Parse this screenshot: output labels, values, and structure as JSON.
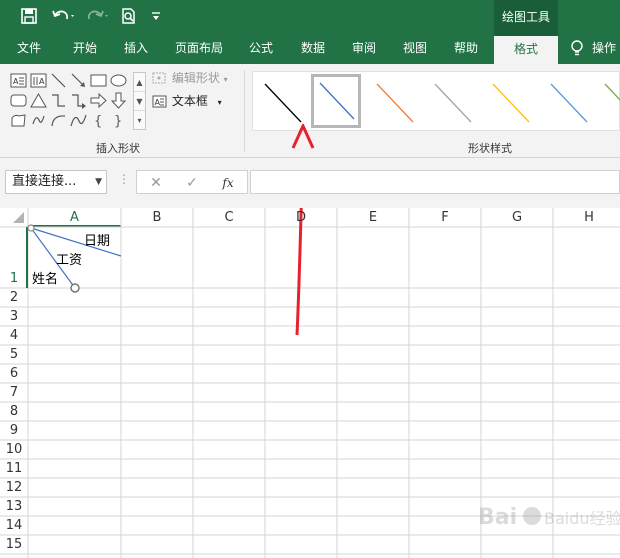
{
  "colors": {
    "accent": "#217346",
    "accent_dark": "#1a5e39",
    "ribbon_bg": "#f3f3f3",
    "annotation_arrow": "#e5222d",
    "diagonal_line": "#4472c4"
  },
  "quick_access": {
    "save_icon": "save-icon",
    "undo_icon": "undo-icon",
    "redo_icon": "redo-icon",
    "print_preview_icon": "print-preview-icon",
    "customize_icon": "customize-toolbar-icon"
  },
  "contextual_tab_group": "绘图工具",
  "tabs": [
    {
      "label": "文件"
    },
    {
      "label": "开始"
    },
    {
      "label": "插入"
    },
    {
      "label": "页面布局"
    },
    {
      "label": "公式"
    },
    {
      "label": "数据"
    },
    {
      "label": "审阅"
    },
    {
      "label": "视图"
    },
    {
      "label": "帮助"
    },
    {
      "label": "格式",
      "active": true
    },
    {
      "label": "操作"
    }
  ],
  "tell_me_icon": "lightbulb-icon",
  "ribbon": {
    "insert_shapes": {
      "group_label": "插入形状",
      "edit_shape_label": "编辑形状",
      "text_box_label": "文本框"
    },
    "shape_styles": {
      "group_label": "形状样式",
      "styles": [
        {
          "color": "#000000",
          "selected": false
        },
        {
          "color": "#4472c4",
          "selected": true
        },
        {
          "color": "#ed7d31",
          "selected": false
        },
        {
          "color": "#a5a5a5",
          "selected": false
        },
        {
          "color": "#ffc000",
          "selected": false
        },
        {
          "color": "#5b9bd5",
          "selected": false
        },
        {
          "color": "#70ad47",
          "selected": false
        }
      ]
    }
  },
  "formula_bar": {
    "name_box": "直接连接...",
    "cancel_label": "✕",
    "enter_label": "✓",
    "function_label": "fx",
    "formula": ""
  },
  "sheet": {
    "columns": [
      "A",
      "B",
      "C",
      "D",
      "E",
      "F",
      "G",
      "H"
    ],
    "selected_column": "A",
    "rows": [
      "1",
      "2",
      "3",
      "4",
      "5",
      "6",
      "7",
      "8",
      "9",
      "10",
      "11",
      "12",
      "13",
      "14",
      "15"
    ],
    "cell_a1_lines": {
      "top": "日期",
      "middle": "工资",
      "bottom": "姓名"
    }
  },
  "watermark_text": "Baidu经验"
}
